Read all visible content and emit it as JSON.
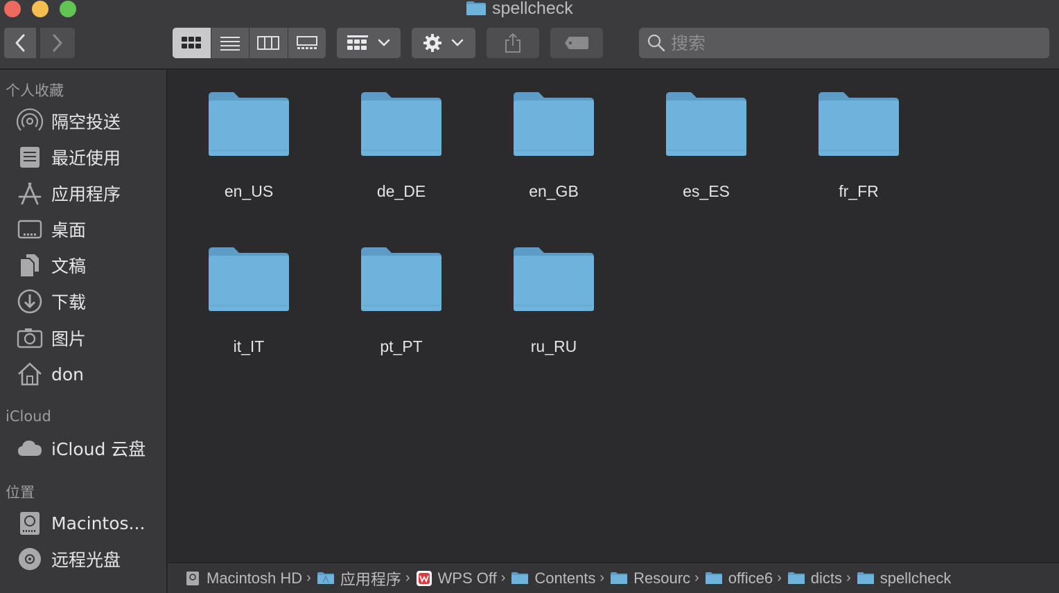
{
  "window": {
    "title": "spellcheck"
  },
  "toolbar": {
    "back_icon": "chevron-left-icon",
    "forward_icon": "chevron-right-icon",
    "view_modes": [
      "icon-view",
      "list-view",
      "column-view",
      "gallery-view"
    ],
    "active_view": "icon-view",
    "search_placeholder": "搜索"
  },
  "sidebar": {
    "sections": [
      {
        "heading": "个人收藏",
        "items": [
          {
            "label": "隔空投送",
            "icon": "airdrop-icon"
          },
          {
            "label": "最近使用",
            "icon": "recents-icon"
          },
          {
            "label": "应用程序",
            "icon": "applications-icon"
          },
          {
            "label": "桌面",
            "icon": "desktop-icon"
          },
          {
            "label": "文稿",
            "icon": "documents-icon"
          },
          {
            "label": "下载",
            "icon": "downloads-icon"
          },
          {
            "label": "图片",
            "icon": "pictures-icon"
          },
          {
            "label": "don",
            "icon": "home-icon"
          }
        ]
      },
      {
        "heading": "iCloud",
        "items": [
          {
            "label": "iCloud 云盘",
            "icon": "cloud-icon"
          }
        ]
      },
      {
        "heading": "位置",
        "items": [
          {
            "label": "Macintos...",
            "icon": "hard-drive-icon"
          },
          {
            "label": "远程光盘",
            "icon": "optical-disc-icon"
          }
        ]
      }
    ]
  },
  "folders": [
    "en_US",
    "de_DE",
    "en_GB",
    "es_ES",
    "fr_FR",
    "it_IT",
    "pt_PT",
    "ru_RU"
  ],
  "pathbar": [
    {
      "label": "Macintosh HD",
      "icon": "hard-drive-icon"
    },
    {
      "label": "应用程序",
      "icon": "applications-folder-icon"
    },
    {
      "label": "WPS Off",
      "icon": "wps-app-icon"
    },
    {
      "label": "Contents",
      "icon": "folder-icon"
    },
    {
      "label": "Resourc",
      "icon": "folder-icon"
    },
    {
      "label": "office6",
      "icon": "folder-icon"
    },
    {
      "label": "dicts",
      "icon": "folder-icon"
    },
    {
      "label": "spellcheck",
      "icon": "folder-icon"
    }
  ],
  "colors": {
    "folder": "#6fb3dc",
    "folder_tab": "#5d9cc6",
    "accent_close": "#ed6a5e",
    "accent_min": "#f5bf4f",
    "accent_max": "#61c554"
  }
}
